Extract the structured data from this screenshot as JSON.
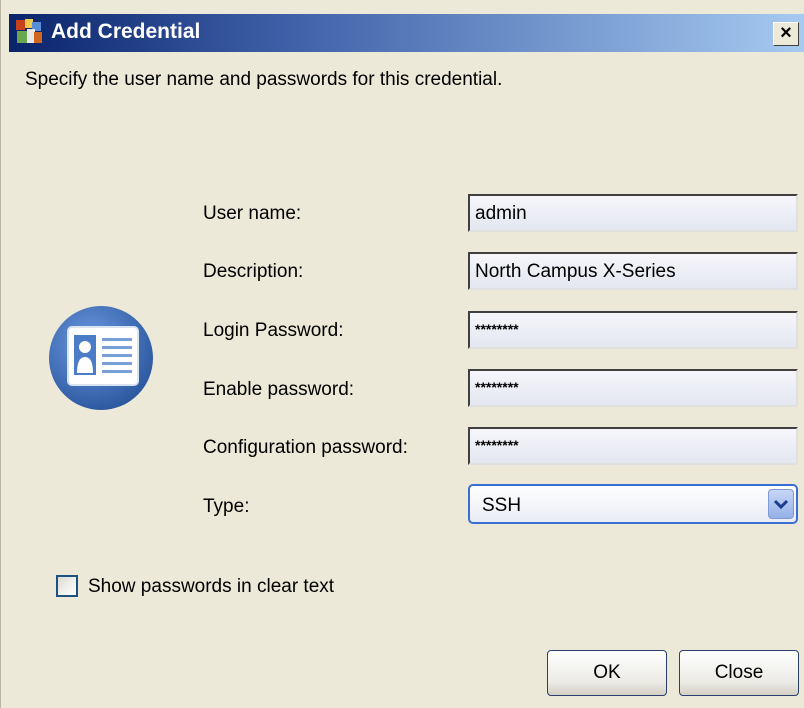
{
  "window": {
    "title": "Add Credential",
    "close_label": "×"
  },
  "instruction": "Specify the user name and passwords for this credential.",
  "form": {
    "username_label": "User name:",
    "username_value": "admin",
    "description_label": "Description:",
    "description_value": "North Campus X-Series",
    "login_password_label": "Login Password:",
    "login_password_value": "********",
    "enable_password_label": "Enable password:",
    "enable_password_value": "********",
    "config_password_label": "Configuration password:",
    "config_password_value": "********",
    "type_label": "Type:",
    "type_value": "SSH"
  },
  "show_passwords_label": "Show passwords in clear text",
  "buttons": {
    "ok": "OK",
    "close": "Close"
  },
  "icons": [
    "app-icon",
    "credential-card-icon",
    "chevron-down-icon"
  ],
  "colors": {
    "title_start": "#0a246a",
    "title_end": "#a6caf0",
    "dialog_bg": "#ece9d8",
    "icon_blue": "#3f72b8"
  }
}
